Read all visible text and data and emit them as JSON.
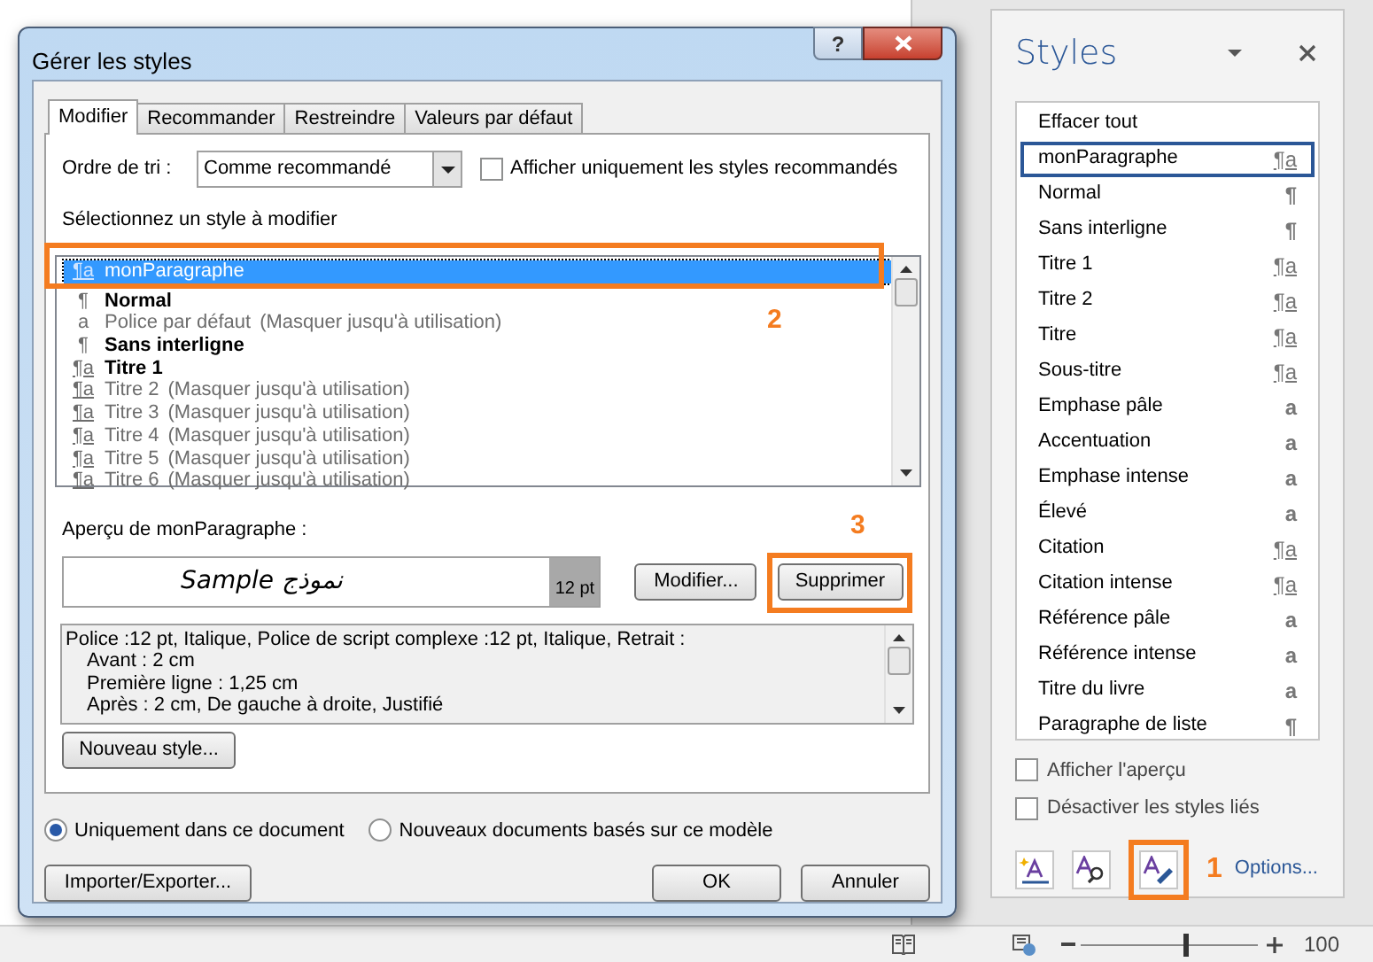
{
  "dialog": {
    "title": "Gérer les styles",
    "help": "?",
    "tabs": [
      {
        "label": "Modifier",
        "selected": true
      },
      {
        "label": "Recommander",
        "selected": false
      },
      {
        "label": "Restreindre",
        "selected": false
      },
      {
        "label": "Valeurs par défaut",
        "selected": false
      }
    ],
    "sort_label": "Ordre de tri :",
    "sort_value": "Comme recommandé",
    "recommended_only": {
      "label": "Afficher uniquement les styles recommandés",
      "checked": false
    },
    "list_label": "Sélectionnez un style à modifier",
    "styles": [
      {
        "symbol": "¶a",
        "kind": "linked",
        "name": "monParagraphe",
        "in_use": false,
        "selected": true
      },
      {
        "symbol": "¶",
        "kind": "paragraph",
        "name": "Normal",
        "in_use": true,
        "selected": false
      },
      {
        "symbol": "a",
        "kind": "character",
        "name": "Police par défaut",
        "note": "(Masquer jusqu'à utilisation)",
        "in_use": false,
        "selected": false
      },
      {
        "symbol": "¶",
        "kind": "paragraph",
        "name": "Sans interligne",
        "in_use": true,
        "selected": false
      },
      {
        "symbol": "¶a",
        "kind": "linked",
        "name": "Titre 1",
        "in_use": true,
        "selected": false
      },
      {
        "symbol": "¶a",
        "kind": "linked",
        "name": "Titre 2",
        "note": "(Masquer jusqu'à utilisation)",
        "in_use": false,
        "selected": false
      },
      {
        "symbol": "¶a",
        "kind": "linked",
        "name": "Titre 3",
        "note": "(Masquer jusqu'à utilisation)",
        "in_use": false,
        "selected": false
      },
      {
        "symbol": "¶a",
        "kind": "linked",
        "name": "Titre 4",
        "note": "(Masquer jusqu'à utilisation)",
        "in_use": false,
        "selected": false
      },
      {
        "symbol": "¶a",
        "kind": "linked",
        "name": "Titre 5",
        "note": "(Masquer jusqu'à utilisation)",
        "in_use": false,
        "selected": false
      },
      {
        "symbol": "¶a",
        "kind": "linked",
        "name": "Titre 6",
        "note": "(Masquer jusqu'à utilisation)",
        "in_use": false,
        "selected": false
      }
    ],
    "callout_list": "2",
    "preview_label": "Aperçu de monParagraphe :",
    "preview_text": "Sample نموذج",
    "preview_size": "12 pt",
    "modify_button": "Modifier...",
    "delete_button": "Supprimer",
    "callout_delete": "3",
    "description": {
      "heading": "Police :12 pt, Italique, Police de script complexe :12 pt, Italique, Retrait :",
      "details": [
        "Avant : 2 cm",
        "Première ligne : 1,25 cm",
        "Après : 2 cm, De gauche à droite, Justifié"
      ]
    },
    "new_style_button": "Nouveau style...",
    "scope": [
      {
        "label": "Uniquement dans ce document",
        "selected": true
      },
      {
        "label": "Nouveaux documents basés sur ce modèle",
        "selected": false
      }
    ],
    "import_export_button": "Importer/Exporter...",
    "ok_button": "OK",
    "cancel_button": "Annuler"
  },
  "styles_pane": {
    "title": "Styles",
    "items": [
      {
        "name": "Effacer tout",
        "selected": false
      },
      {
        "name": "monParagraphe",
        "symbol": "¶a",
        "kind": "linked",
        "selected": true
      },
      {
        "name": "Normal",
        "symbol": "¶",
        "kind": "paragraph",
        "selected": false
      },
      {
        "name": "Sans interligne",
        "symbol": "¶",
        "kind": "paragraph",
        "selected": false
      },
      {
        "name": "Titre 1",
        "symbol": "¶a",
        "kind": "linked",
        "selected": false
      },
      {
        "name": "Titre 2",
        "symbol": "¶a",
        "kind": "linked",
        "selected": false
      },
      {
        "name": "Titre",
        "symbol": "¶a",
        "kind": "linked",
        "selected": false
      },
      {
        "name": "Sous-titre",
        "symbol": "¶a",
        "kind": "linked",
        "selected": false
      },
      {
        "name": "Emphase pâle",
        "symbol": "a",
        "kind": "character",
        "selected": false
      },
      {
        "name": "Accentuation",
        "symbol": "a",
        "kind": "character",
        "selected": false
      },
      {
        "name": "Emphase intense",
        "symbol": "a",
        "kind": "character",
        "selected": false
      },
      {
        "name": "Élevé",
        "symbol": "a",
        "kind": "character",
        "selected": false
      },
      {
        "name": "Citation",
        "symbol": "¶a",
        "kind": "linked",
        "selected": false
      },
      {
        "name": "Citation intense",
        "symbol": "¶a",
        "kind": "linked",
        "selected": false
      },
      {
        "name": "Référence pâle",
        "symbol": "a",
        "kind": "character",
        "selected": false
      },
      {
        "name": "Référence intense",
        "symbol": "a",
        "kind": "character",
        "selected": false
      },
      {
        "name": "Titre du livre",
        "symbol": "a",
        "kind": "character",
        "selected": false
      },
      {
        "name": "Paragraphe de liste",
        "symbol": "¶",
        "kind": "paragraph",
        "selected": false
      }
    ],
    "options": [
      {
        "label": "Afficher l'aperçu",
        "checked": false
      },
      {
        "label": "Désactiver les styles liés",
        "checked": false
      }
    ],
    "callout_manage": "1",
    "options_link": "Options..."
  },
  "status_bar": {
    "zoom": {
      "level": 0.58
    },
    "zoom_value": "100"
  }
}
